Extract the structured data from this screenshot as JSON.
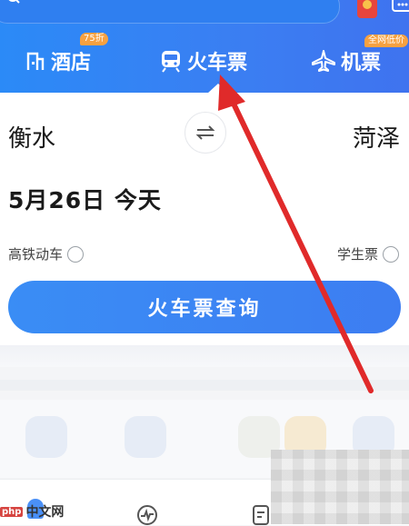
{
  "tabs": {
    "hotel": {
      "label": "酒店",
      "badge": "75折"
    },
    "train": {
      "label": "火车票"
    },
    "flight": {
      "label": "机票",
      "badge": "全网低价"
    }
  },
  "route": {
    "from": "衡水",
    "to": "菏泽"
  },
  "date": {
    "text": "5月26日 今天"
  },
  "options": {
    "gaotie": "高铁动车",
    "student": "学生票"
  },
  "query_button": "火车票查询",
  "watermark": {
    "badge": "php",
    "text": "中文网"
  },
  "colors": {
    "header": "#3b7ef2",
    "button": "#3a8df5",
    "annotation_arrow": "#e02a2a"
  }
}
